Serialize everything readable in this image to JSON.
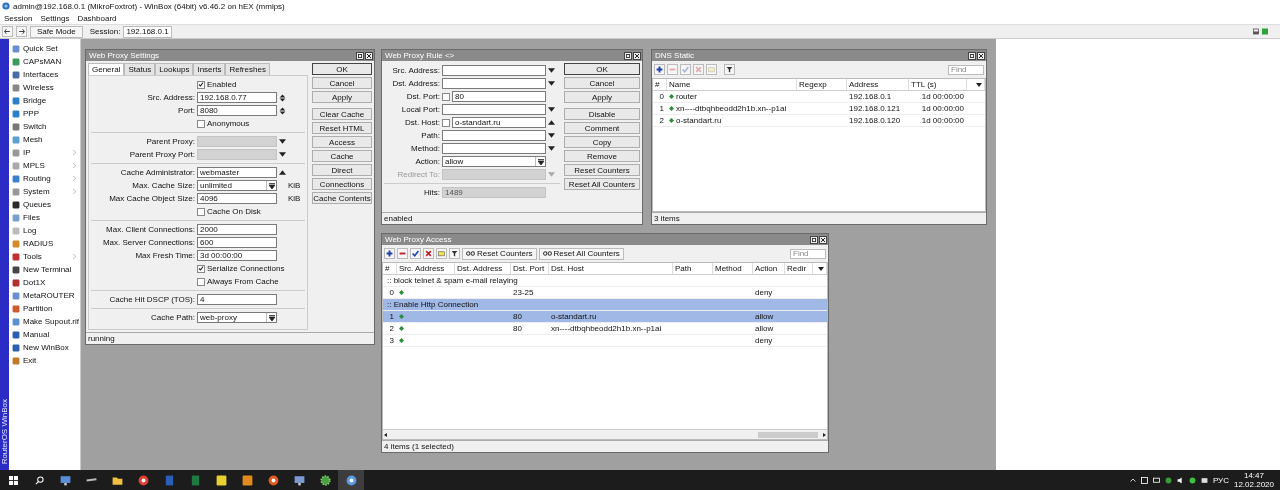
{
  "window": {
    "title": "admin@192.168.0.1 (MikroFoxtrot) - WinBox (64bit) v6.46.2 on hEX (mmips)"
  },
  "menu": [
    "Session",
    "Settings",
    "Dashboard"
  ],
  "toolbar": {
    "safe_mode": "Safe Mode",
    "session_label": "Session:",
    "session_value": "192.168.0.1"
  },
  "side_label": "RouterOS WinBox",
  "sidebar": [
    {
      "label": "Quick Set",
      "submenu": false
    },
    {
      "label": "CAPsMAN",
      "submenu": false
    },
    {
      "label": "Interfaces",
      "submenu": false
    },
    {
      "label": "Wireless",
      "submenu": false
    },
    {
      "label": "Bridge",
      "submenu": false
    },
    {
      "label": "PPP",
      "submenu": false
    },
    {
      "label": "Switch",
      "submenu": false
    },
    {
      "label": "Mesh",
      "submenu": false
    },
    {
      "label": "IP",
      "submenu": true
    },
    {
      "label": "MPLS",
      "submenu": true
    },
    {
      "label": "Routing",
      "submenu": true
    },
    {
      "label": "System",
      "submenu": true
    },
    {
      "label": "Queues",
      "submenu": false
    },
    {
      "label": "Files",
      "submenu": false
    },
    {
      "label": "Log",
      "submenu": false
    },
    {
      "label": "RADIUS",
      "submenu": false
    },
    {
      "label": "Tools",
      "submenu": true
    },
    {
      "label": "New Terminal",
      "submenu": false
    },
    {
      "label": "Dot1X",
      "submenu": false
    },
    {
      "label": "MetaROUTER",
      "submenu": false
    },
    {
      "label": "Partition",
      "submenu": false
    },
    {
      "label": "Make Supout.rif",
      "submenu": false
    },
    {
      "label": "Manual",
      "submenu": false
    },
    {
      "label": "New WinBox",
      "submenu": false
    },
    {
      "label": "Exit",
      "submenu": false
    }
  ],
  "proxy_settings": {
    "title": "Web Proxy Settings",
    "tabs": [
      {
        "label": "General",
        "selected": true
      },
      {
        "label": "Status",
        "selected": false
      },
      {
        "label": "Lookups",
        "selected": false
      },
      {
        "label": "Inserts",
        "selected": false
      },
      {
        "label": "Refreshes",
        "selected": false
      }
    ],
    "rows": [
      {
        "kind": "check",
        "label": "Enabled",
        "checked": true
      },
      {
        "kind": "spin",
        "label": "Src. Address:",
        "value": "192.168.0.77",
        "disabled": false
      },
      {
        "kind": "spin",
        "label": "Port:",
        "value": "8080",
        "disabled": false
      },
      {
        "kind": "check",
        "label": "Anonymous",
        "checked": false
      },
      {
        "kind": "sep"
      },
      {
        "kind": "locked-dropdown",
        "label": "Parent Proxy:",
        "disabled": false
      },
      {
        "kind": "locked-dropdown",
        "label": "Parent Proxy Port:",
        "disabled": false
      },
      {
        "kind": "sep"
      },
      {
        "kind": "collapse",
        "label": "Cache Administrator:",
        "value": "webmaster",
        "disabled": false
      },
      {
        "kind": "combo",
        "label": "Max. Cache Size:",
        "value": "unlimited",
        "unit": "KiB",
        "disabled": false
      },
      {
        "kind": "field",
        "label": "Max Cache Object Size:",
        "value": "4096",
        "unit": "KiB",
        "disabled": false
      },
      {
        "kind": "check",
        "label": "Cache On Disk",
        "checked": false
      },
      {
        "kind": "sep"
      },
      {
        "kind": "field",
        "label": "Max. Client Connections:",
        "value": "2000",
        "disabled": false
      },
      {
        "kind": "field",
        "label": "Max. Server Connections:",
        "value": "600",
        "disabled": false
      },
      {
        "kind": "field",
        "label": "Max Fresh Time:",
        "value": "3d 00:00:00",
        "disabled": false
      },
      {
        "kind": "check",
        "label": "Serialize Connections",
        "checked": true
      },
      {
        "kind": "check",
        "label": "Always From Cache",
        "checked": false
      },
      {
        "kind": "sep"
      },
      {
        "kind": "field",
        "label": "Cache Hit DSCP (TOS):",
        "value": "4",
        "disabled": false
      },
      {
        "kind": "sep"
      },
      {
        "kind": "combo",
        "label": "Cache Path:",
        "value": "web-proxy",
        "disabled": false
      }
    ],
    "buttons": [
      [
        "OK",
        "Cancel",
        "Apply"
      ],
      [
        "Clear Cache",
        "Reset HTML",
        "Access",
        "Cache",
        "Direct",
        "Connections",
        "Cache Contents"
      ]
    ],
    "status": "running"
  },
  "proxy_rule": {
    "title": "Web Proxy Rule <>",
    "rows": [
      {
        "kind": "dropdown",
        "label": "Src. Address:",
        "disabled": false
      },
      {
        "kind": "dropdown",
        "label": "Dst. Address:",
        "disabled": false
      },
      {
        "kind": "neg",
        "label": "Dst. Port:",
        "value": "80",
        "checked": false,
        "disabled": false
      },
      {
        "kind": "dropdown",
        "label": "Local Port:",
        "disabled": false
      },
      {
        "kind": "neg-collapse",
        "label": "Dst. Host:",
        "value": "o-standart.ru",
        "checked": false,
        "disabled": false
      },
      {
        "kind": "dropdown",
        "label": "Path:",
        "disabled": false
      },
      {
        "kind": "dropdown",
        "label": "Method:",
        "disabled": false
      },
      {
        "kind": "combo",
        "label": "Action:",
        "value": "allow",
        "disabled": false
      },
      {
        "kind": "dropdown",
        "label": "Redirect To:",
        "disabled": true
      },
      {
        "kind": "sep"
      },
      {
        "kind": "locked",
        "label": "Hits:",
        "value": "1489",
        "disabled": false
      }
    ],
    "buttons": [
      [
        "OK",
        "Cancel",
        "Apply"
      ],
      [
        "Disable",
        "Comment",
        "Copy",
        "Remove",
        "Reset Counters",
        "Reset All Counters"
      ]
    ],
    "status": "enabled"
  },
  "dns_static": {
    "title": "DNS Static",
    "find_placeholder": "Find",
    "columns": [
      "#",
      "Name",
      "Regexp",
      "Address",
      "TTL (s)"
    ],
    "rows": [
      {
        "num": "0",
        "name": "router",
        "address": "192.168.0.1",
        "ttl": "1d 00:00:00"
      },
      {
        "num": "1",
        "name": "xn----dtbqhbeodd2h1b.xn--p1ai",
        "address": "192.168.0.121",
        "ttl": "1d 00:00:00"
      },
      {
        "num": "2",
        "name": "o-standart.ru",
        "address": "192.168.0.120",
        "ttl": "1d 00:00:00"
      }
    ],
    "status": "3 items"
  },
  "proxy_access": {
    "title": "Web Proxy Access",
    "find_placeholder": "Find",
    "tool_buttons": [
      "Reset Counters",
      "Reset All Counters"
    ],
    "columns": [
      "#",
      "Src. Address",
      "Dst. Address",
      "Dst. Port",
      "Dst. Host",
      "Path",
      "Method",
      "Action",
      "Redir"
    ],
    "rows": [
      {
        "kind": "comment",
        "text": ":: block telnet & spam e-mail relaying",
        "selected": false
      },
      {
        "kind": "rule",
        "num": "0",
        "dst_port": "23-25",
        "action": "deny",
        "selected": false
      },
      {
        "kind": "comment",
        "text": ":: Enable Http Connection",
        "selected": true
      },
      {
        "kind": "rule",
        "num": "1",
        "dst_port": "80",
        "dst_host": "o-standart.ru",
        "action": "allow",
        "selected": true
      },
      {
        "kind": "rule",
        "num": "2",
        "dst_port": "80",
        "dst_host": "xn----dtbqhbeodd2h1b.xn--p1ai",
        "action": "allow",
        "selected": false
      },
      {
        "kind": "rule",
        "num": "3",
        "action": "deny",
        "selected": false
      }
    ],
    "status": "4 items (1 selected)"
  },
  "taskbar": {
    "language": "РУС",
    "time": "14:47",
    "date": "12.02.2020"
  }
}
